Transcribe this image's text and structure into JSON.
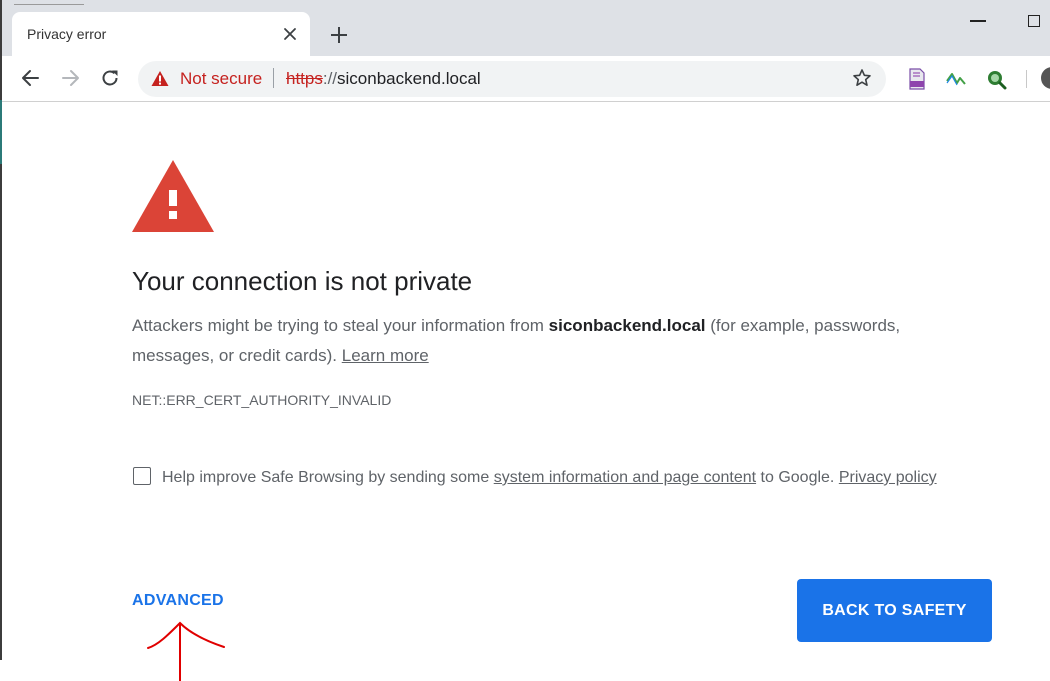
{
  "tab": {
    "title": "Privacy error"
  },
  "omnibox": {
    "security_label": "Not secure",
    "url_scheme": "https",
    "url_separator": "://",
    "url_host": "siconbackend.local"
  },
  "interstitial": {
    "heading": "Your connection is not private",
    "explanation_before": "Attackers might be trying to steal your information from ",
    "host": "siconbackend.local",
    "explanation_after": " (for example, passwords, messages, or credit cards). ",
    "learn_more": "Learn more",
    "error_code": "NET::ERR_CERT_AUTHORITY_INVALID",
    "safe_browsing_before": "Help improve Safe Browsing by sending some ",
    "safe_browsing_link": "system information and page content",
    "safe_browsing_middle": " to Google. ",
    "privacy_policy": "Privacy policy",
    "advanced_label": "ADVANCED",
    "back_button_label": "BACK TO SAFETY"
  },
  "colors": {
    "accent": "#1a73e8",
    "danger": "#c5221f",
    "warning_triangle": "#db4437"
  }
}
